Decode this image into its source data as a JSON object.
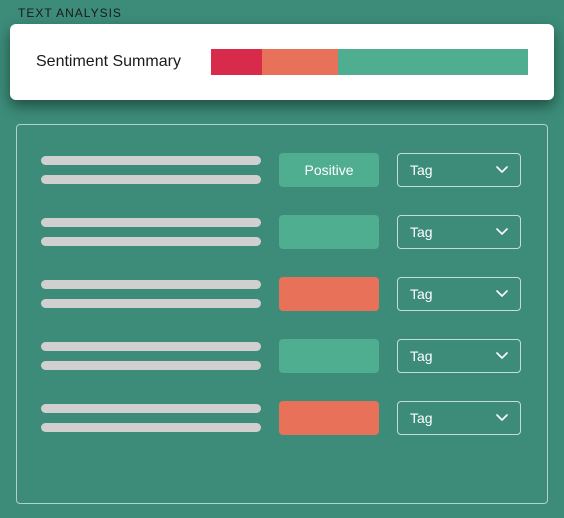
{
  "header": {
    "label": "TEXT ANALYSIS"
  },
  "summary": {
    "title": "Sentiment Summary",
    "segments": [
      {
        "color": "red",
        "pct": 16
      },
      {
        "color": "orange",
        "pct": 24
      },
      {
        "color": "green",
        "pct": 60
      }
    ]
  },
  "rows": [
    {
      "badge_label": "Positive",
      "badge_color": "green",
      "tag_label": "Tag"
    },
    {
      "badge_label": "",
      "badge_color": "green",
      "tag_label": "Tag"
    },
    {
      "badge_label": "",
      "badge_color": "orange",
      "tag_label": "Tag"
    },
    {
      "badge_label": "",
      "badge_color": "green",
      "tag_label": "Tag"
    },
    {
      "badge_label": "",
      "badge_color": "orange",
      "tag_label": "Tag"
    }
  ]
}
